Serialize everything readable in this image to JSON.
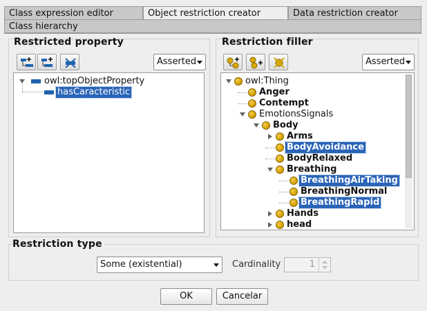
{
  "tabs": {
    "row1": [
      {
        "label": "Class expression editor",
        "active": false
      },
      {
        "label": "Object restriction creator",
        "active": true
      },
      {
        "label": "Data restriction creator",
        "active": false
      }
    ],
    "row2": [
      {
        "label": "Class hierarchy",
        "active": false
      }
    ]
  },
  "restricted_property": {
    "title": "Restricted property",
    "mode": "Asserted",
    "toolbar_icons": [
      "add-subproperty-icon",
      "add-sibling-property-icon",
      "delete-property-icon"
    ],
    "tree": [
      {
        "label": "owl:topObjectProperty",
        "level": 0,
        "expanded": true,
        "selected": false
      },
      {
        "label": "hasCaracteristic",
        "level": 1,
        "selected": true
      }
    ]
  },
  "restriction_filler": {
    "title": "Restriction filler",
    "mode": "Asserted",
    "toolbar_icons": [
      "add-subclass-icon",
      "add-sibling-class-icon",
      "delete-class-icon"
    ],
    "tree": [
      {
        "label": "owl:Thing",
        "level": 0,
        "toggle": "open",
        "bold": false,
        "selected": false
      },
      {
        "label": "Anger",
        "level": 1,
        "toggle": "none",
        "bold": true,
        "selected": false
      },
      {
        "label": "Contempt",
        "level": 1,
        "toggle": "none",
        "bold": true,
        "selected": false
      },
      {
        "label": "EmotionsSignals",
        "level": 1,
        "toggle": "open",
        "bold": false,
        "selected": false
      },
      {
        "label": "Body",
        "level": 2,
        "toggle": "open",
        "bold": true,
        "selected": false
      },
      {
        "label": "Arms",
        "level": 3,
        "toggle": "closed",
        "bold": true,
        "selected": false
      },
      {
        "label": "BodyAvoidance",
        "level": 3,
        "toggle": "none",
        "bold": true,
        "selected": true
      },
      {
        "label": "BodyRelaxed",
        "level": 3,
        "toggle": "none",
        "bold": true,
        "selected": false
      },
      {
        "label": "Breathing",
        "level": 3,
        "toggle": "open",
        "bold": true,
        "selected": false
      },
      {
        "label": "BreathingAirTaking",
        "level": 4,
        "toggle": "none",
        "bold": true,
        "selected": true
      },
      {
        "label": "BreathingNormal",
        "level": 4,
        "toggle": "none",
        "bold": true,
        "selected": false
      },
      {
        "label": "BreathingRapid",
        "level": 4,
        "toggle": "none",
        "bold": true,
        "selected": true
      },
      {
        "label": "Hands",
        "level": 3,
        "toggle": "closed",
        "bold": true,
        "selected": false
      },
      {
        "label": "head",
        "level": 3,
        "toggle": "closed",
        "bold": true,
        "selected": false
      }
    ]
  },
  "restriction_type": {
    "title": "Restriction type",
    "selected": "Some (existential)",
    "cardinality_label": "Cardinality",
    "cardinality_value": "1"
  },
  "buttons": {
    "ok": "OK",
    "cancel": "Cancelar"
  }
}
